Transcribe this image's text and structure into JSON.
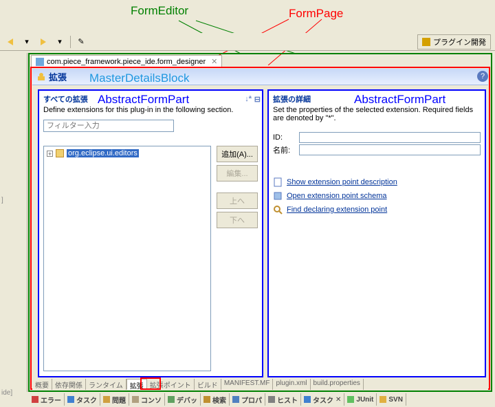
{
  "annotations": {
    "formeditor": "FormEditor",
    "formpage": "FormPage",
    "masterdetails": "MasterDetailsBlock",
    "abstractformpart": "AbstractFormPart"
  },
  "toolbar": {
    "perspective_label": "プラグイン開発"
  },
  "editor_tab": {
    "label": "com.piece_framework.piece_ide.form_designer",
    "close": "✕"
  },
  "form_header": {
    "title": "拡張"
  },
  "master": {
    "title": "すべての拡張",
    "desc": "Define extensions for this plug-in in the following section.",
    "filter_placeholder": "フィルター入力",
    "tree_item": "org.eclipse.ui.editors",
    "buttons": {
      "add": "追加(A)...",
      "edit": "編集...",
      "up": "上へ",
      "down": "下へ"
    }
  },
  "details": {
    "title": "拡張の詳細",
    "desc": "Set the properties of the selected extension. Required fields are denoted by \"*\".",
    "id_label": "ID:",
    "name_label": "名前:",
    "id_value": "",
    "name_value": "",
    "links": {
      "show": "Show extension point description",
      "open": "Open extension point schema",
      "find": "Find declaring extension point"
    }
  },
  "page_tabs": [
    "概要",
    "依存関係",
    "ランタイム",
    "拡張",
    "拡張ポイント",
    "ビルド",
    "MANIFEST.MF",
    "plugin.xml",
    "build.properties"
  ],
  "bottom_tabs": [
    "エラー",
    "タスク",
    "問題",
    "コンソ",
    "デバッ",
    "検索",
    "プロパ",
    "ヒスト",
    "タスク",
    "JUnit",
    "SVN"
  ],
  "sidebar": {
    "marker1": "]",
    "marker2": "ide]"
  },
  "help": "?"
}
